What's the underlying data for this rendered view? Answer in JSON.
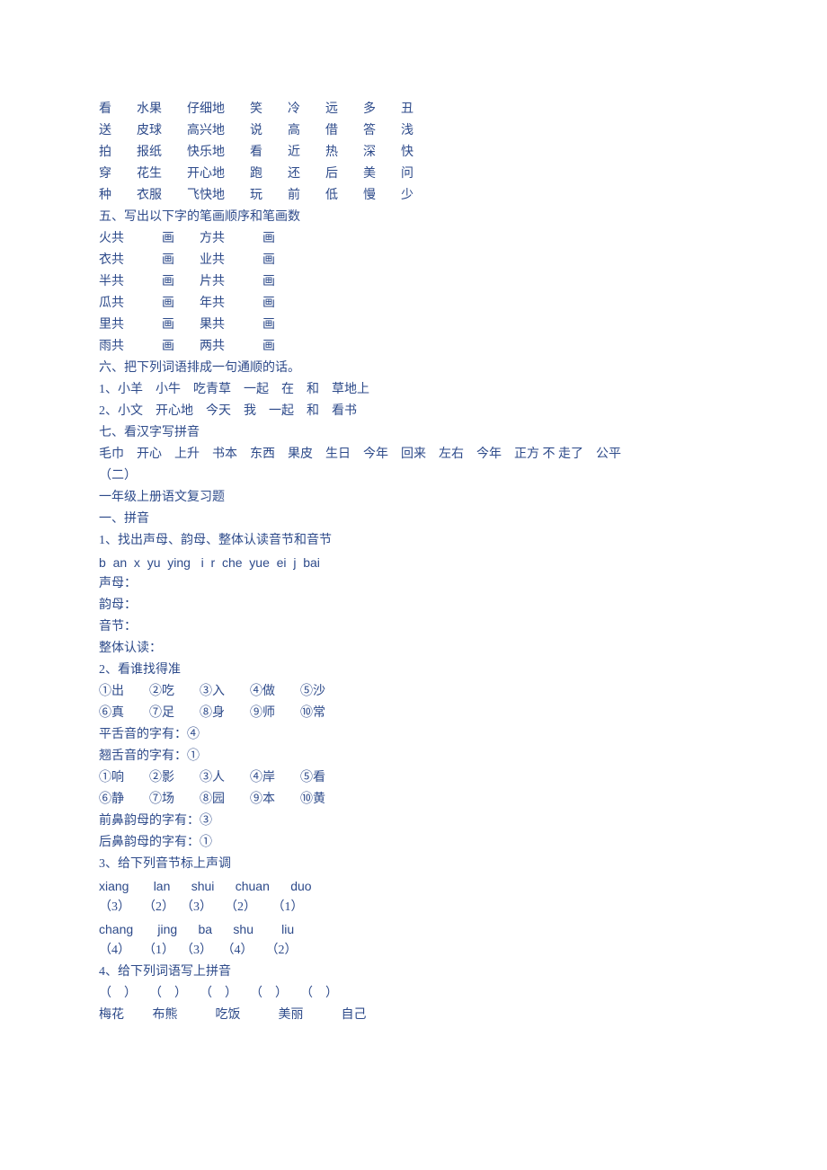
{
  "lines": [
    "看　　水果　　仔细地　　笑　　冷　　远　　多　　丑",
    "送　　皮球　　高兴地　　说　　高　　借　　答　　浅",
    "拍　　报纸　　快乐地　　看　　近　　热　　深　　快",
    "穿　　花生　　开心地　　跑　　还　　后　　美　　问",
    "种　　衣服　　飞快地　　玩　　前　　低　　慢　　少",
    "五、写出以下字的笔画顺序和笔画数",
    "火共　　　画　　方共　　　画",
    "衣共　　　画　　业共　　　画",
    "半共　　　画　　片共　　　画",
    "瓜共　　　画　　年共　　　画",
    "里共　　　画　　果共　　　画",
    "雨共　　　画　　两共　　　画",
    "六、把下列词语排成一句通顺的话。",
    "1、小羊　小牛　吃青草　一起　在　和　草地上",
    "2、小文　开心地　今天　我　一起　和　看书",
    "七、看汉字写拼音",
    "毛巾　开心　上升　书本　东西　果皮　生日　今年　回来　左右　今年　正方 不 走了　公平",
    "",
    "（二）",
    "一年级上册语文复习题",
    "一、拼音",
    "1、找出声母、韵母、整体认读音节和音节",
    "b  an  x  yu  ying   i  r  che  yue  ei  j  bai",
    "声母：",
    "韵母：",
    "音节：",
    "整体认读：",
    "2、看谁找得准",
    "①出　　②吃　　③入　　④做　　⑤沙",
    "⑥真　　⑦足　　⑧身　　⑨师　　⑩常",
    "平舌音的字有：④",
    "翘舌音的字有：①",
    "①响　　②影　　③人　　④岸　　⑤看",
    "⑥静　　⑦场　　⑧园　　⑨本　　⑩黄",
    "前鼻韵母的字有：③",
    "后鼻韵母的字有：①",
    "3、给下列音节标上声调",
    "xiang       lan      shui      chuan      duo",
    "（3）    （2）  （3）    （2）     （1）",
    "chang       jing      ba      shu        liu",
    "（4）    （1）  （3）   （4）    （2）",
    "4、给下列词语写上拼音",
    "（　）　　（　）　　（　）　　（　）　　（　）",
    "梅花　　 布熊　　　吃饭　　　美丽　　　自己"
  ]
}
